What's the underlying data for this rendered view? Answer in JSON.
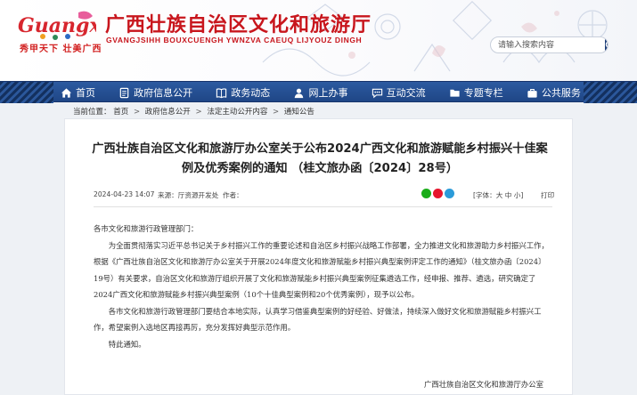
{
  "header": {
    "logo_text": "Guangxi",
    "slogan": "秀甲天下 壮美广西",
    "title": "广西壮族自治区文化和旅游厅",
    "subtitle": "GVANGJSIHH BOUXCUENGH YWNZVA CAEUQ LIJYOUZ DINGH",
    "search_placeholder": "请输入搜索内容",
    "accent_color": "#c8161d",
    "nav_color": "#1f4686"
  },
  "nav": {
    "items": [
      {
        "label": "首页",
        "icon": "home-icon"
      },
      {
        "label": "政府信息公开",
        "icon": "document-icon"
      },
      {
        "label": "政务动态",
        "icon": "book-icon"
      },
      {
        "label": "网上办事",
        "icon": "person-icon"
      },
      {
        "label": "互动交流",
        "icon": "chat-icon"
      },
      {
        "label": "专题专栏",
        "icon": "folder-icon"
      },
      {
        "label": "公共服务",
        "icon": "briefcase-icon"
      }
    ]
  },
  "breadcrumb": {
    "prefix": "当前位置：",
    "items": [
      "首页",
      "政府信息公开",
      "法定主动公开内容",
      "通知公告"
    ],
    "separator": ">"
  },
  "article": {
    "title": "广西壮族自治区文化和旅游厅办公室关于公布2024广西文化和旅游赋能乡村振兴十佳案例及优秀案例的通知 （桂文旅办函〔2024〕28号）",
    "date": "2024-04-23 14:07",
    "source": "来源：厅资源开发处",
    "author": "作者：",
    "font_size": "[字体：大 中 小]",
    "print": "打印",
    "paragraphs": [
      "各市文化和旅游行政管理部门：",
      "为全面贯彻落实习近平总书记关于乡村振兴工作的重要论述和自治区乡村振兴战略工作部署，全力推进文化和旅游助力乡村振兴工作，根据《广西壮族自治区文化和旅游厅办公室关于开展2024年度文化和旅游赋能乡村振兴典型案例评定工作的通知》（桂文旅办函〔2024〕19号）有关要求，自治区文化和旅游厅组织开展了文化和旅游赋能乡村振兴典型案例征集遴选工作，经申报、推荐、遴选，研究确定了2024广西文化和旅游赋能乡村振兴典型案例（10个十佳典型案例和20个优秀案例），现予以公布。",
      "各市文化和旅游行政管理部门要结合本地实际，认真学习借鉴典型案例的好经验、好做法，持续深入做好文化和旅游赋能乡村振兴工作，希望案例入选地区再接再厉，充分发挥好典型示范作用。",
      "特此通知。"
    ],
    "signature": "广西壮族自治区文化和旅游厅办公室"
  }
}
